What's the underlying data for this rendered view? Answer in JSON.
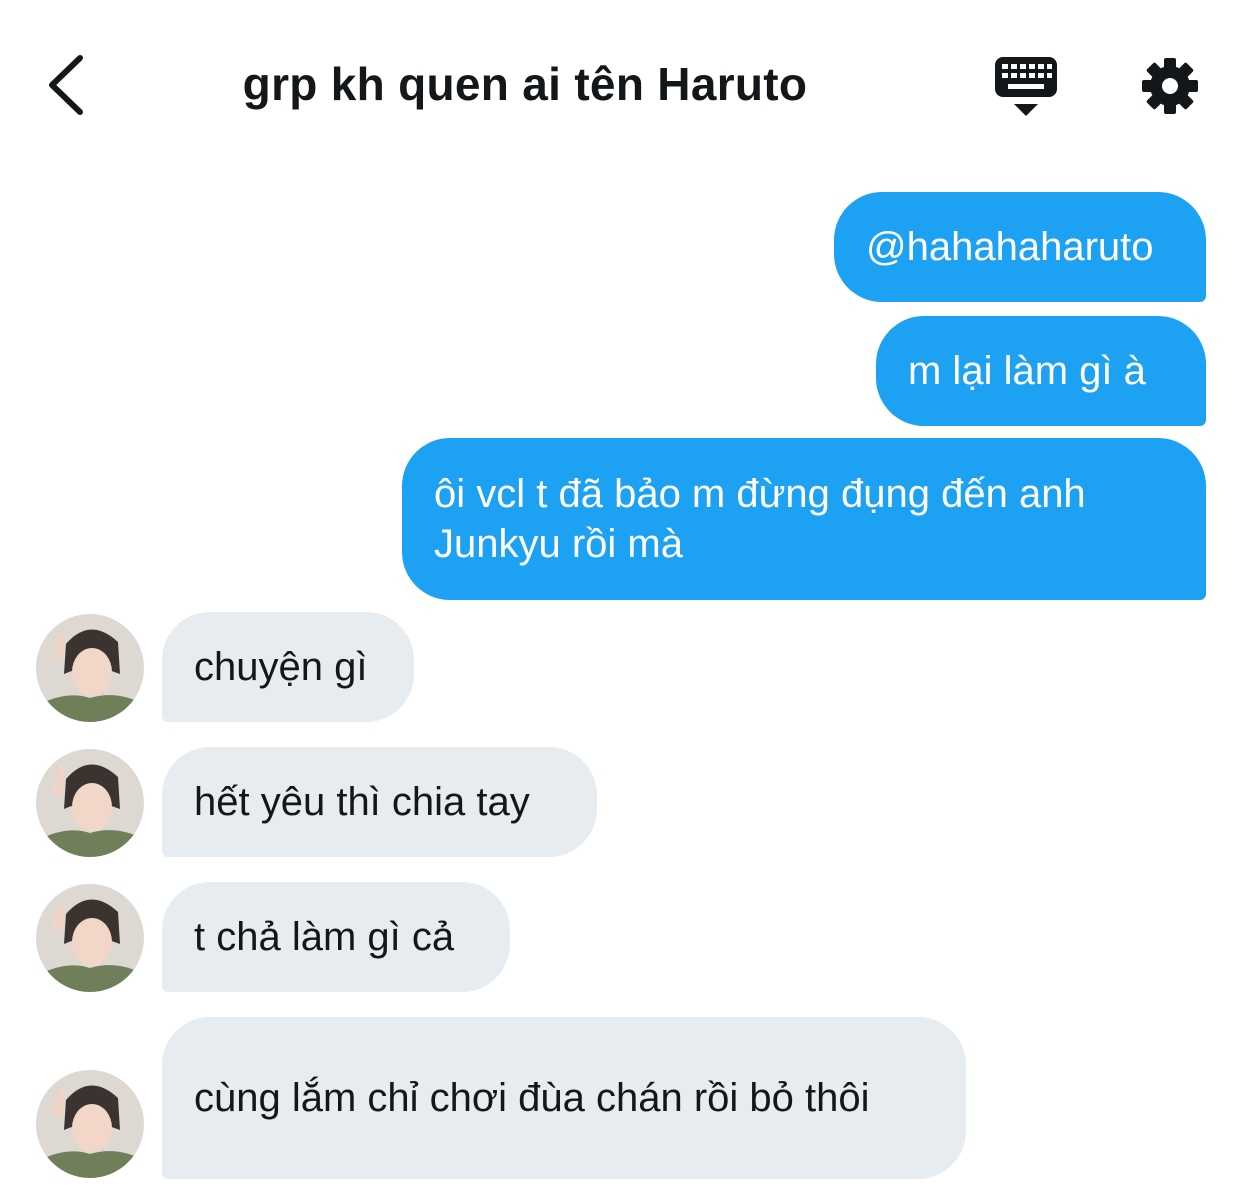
{
  "header": {
    "title": "grp kh quen ai tên Haruto",
    "back_icon": "chevron-left-icon",
    "keyboard_icon": "keyboard-icon",
    "settings_icon": "gear-icon"
  },
  "colors": {
    "outgoing_bubble": "#1da1f2",
    "incoming_bubble": "#e6ecf0",
    "text": "#14171a"
  },
  "messages": [
    {
      "direction": "outgoing",
      "text": "@hahahaharuto"
    },
    {
      "direction": "outgoing",
      "text": "m lại làm gì à"
    },
    {
      "direction": "outgoing",
      "text": "ôi vcl t đã bảo m đừng đụng đến anh Junkyu rồi mà"
    },
    {
      "direction": "incoming",
      "text": "chuyện gì"
    },
    {
      "direction": "incoming",
      "text": "hết yêu thì chia tay"
    },
    {
      "direction": "incoming",
      "text": "t chả làm gì cả"
    },
    {
      "direction": "incoming",
      "text": "cùng lắm chỉ chơi đùa chán rồi bỏ thôi"
    }
  ]
}
